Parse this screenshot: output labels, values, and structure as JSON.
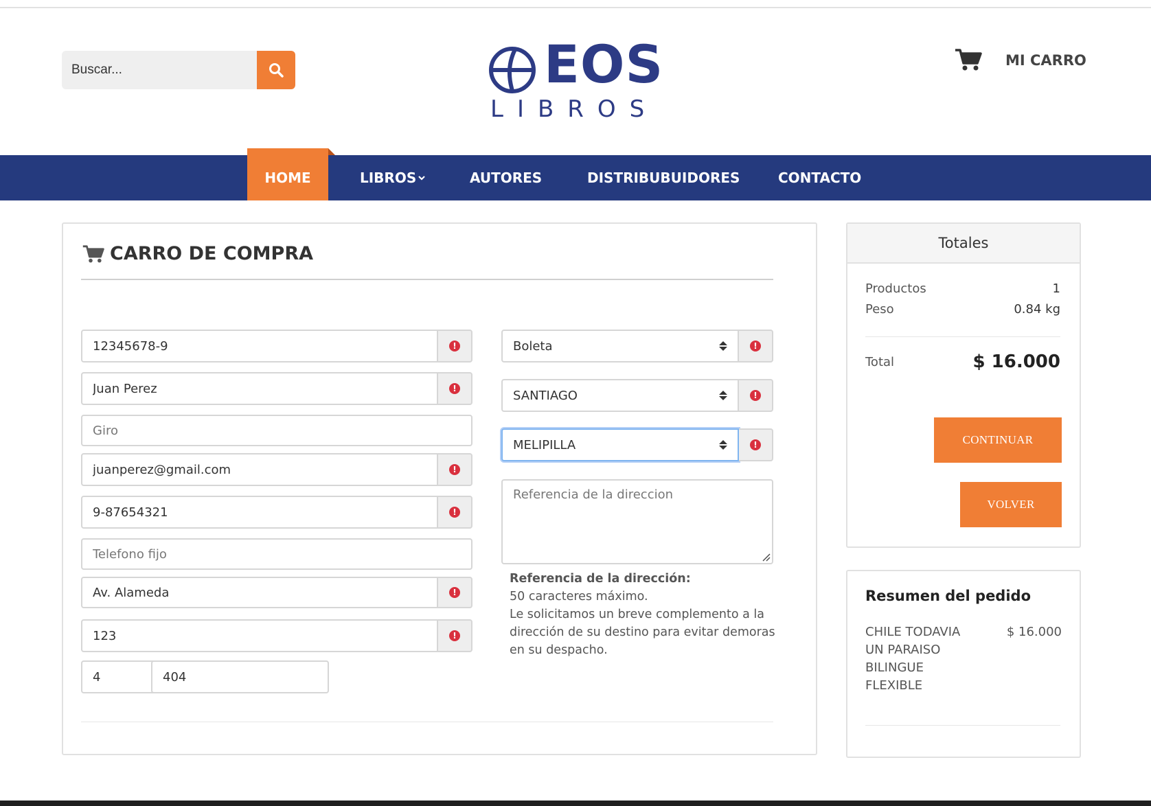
{
  "header": {
    "search_placeholder": "Buscar...",
    "logo_top": "EOS",
    "logo_bottom": "LIBROS",
    "cart_label": "MI CARRO"
  },
  "nav": {
    "items": [
      "HOME",
      "LIBROS",
      "AUTORES",
      "DISTRIBUBUIDORES",
      "CONTACTO"
    ],
    "active": "HOME"
  },
  "cart": {
    "title": "CARRO DE COMPRA",
    "left_fields": {
      "rut": "12345678-9",
      "name": "Juan Perez",
      "giro_placeholder": "Giro",
      "email": "juanperez@gmail.com",
      "phone": "9-87654321",
      "landline_placeholder": "Telefono fijo",
      "street": "Av. Alameda",
      "number": "123",
      "floor": "4",
      "apartment": "404"
    },
    "right_fields": {
      "document_type": "Boleta",
      "region": "SANTIAGO",
      "comuna": "MELIPILLA",
      "reference_placeholder": "Referencia de la direccion"
    },
    "help": {
      "title": "Referencia de la dirección:",
      "line1": "50 caracteres máximo.",
      "line2": "Le solicitamos un breve complemento a la dirección de su destino para evitar demoras en su despacho."
    }
  },
  "totals": {
    "title": "Totales",
    "products_label": "Productos",
    "products_value": "1",
    "weight_label": "Peso",
    "weight_value": "0.84 kg",
    "total_label": "Total",
    "total_value": "$ 16.000",
    "continue_label": "CONTINUAR",
    "back_label": "VOLVER"
  },
  "summary": {
    "title": "Resumen del pedido",
    "item_name": "CHILE TODAVIA UN PARAISO BILINGUE FLEXIBLE",
    "item_price": "$ 16.000"
  },
  "colors": {
    "accent": "#f07e35",
    "nav": "#253a7e",
    "logo": "#2d3b85",
    "alert": "#d9303e"
  }
}
